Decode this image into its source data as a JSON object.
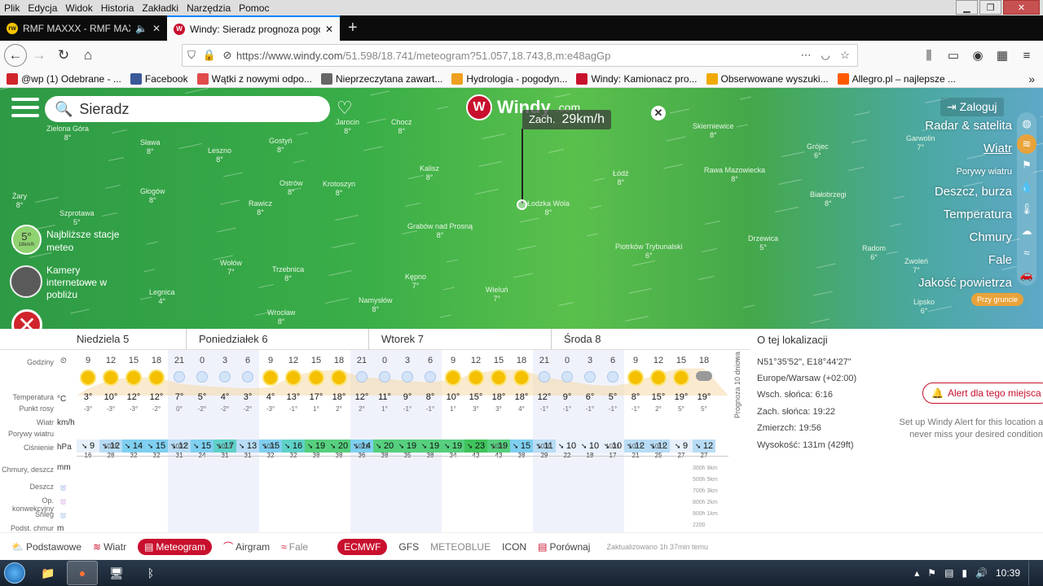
{
  "browser": {
    "menu": [
      "Plik",
      "Edycja",
      "Widok",
      "Historia",
      "Zakładki",
      "Narzędzia",
      "Pomoc"
    ],
    "tabs": [
      {
        "label": "RMF MAXXX - RMF MAXXX",
        "active": false
      },
      {
        "label": "Windy: Sieradz prognoza pogo",
        "active": true
      }
    ],
    "url_host": "https://www.windy.com",
    "url_path": "/51.598/18.741/meteogram?51.057,18.743,8,m:e48agGp",
    "bookmarks": [
      "@wp (1) Odebrane - ...",
      "Facebook",
      "Wątki z nowymi odpo...",
      "Nieprzeczytana zawart...",
      "Hydrologia - pogodyn...",
      "Windy: Kamionacz pro...",
      "Obserwowane wyszuki...",
      "Allegro.pl – najlepsze ..."
    ]
  },
  "map": {
    "search_value": "Sieradz",
    "logo_text": "Windy",
    "logo_suffix": ".com",
    "wind_dir": "Zach.",
    "wind_speed": "29km/h",
    "login": "Zaloguj",
    "layers": [
      {
        "label": "Radar & satelita",
        "sub": false,
        "active": false
      },
      {
        "label": "Wiatr",
        "sub": false,
        "active": true
      },
      {
        "label": "Porywy wiatru",
        "sub": true,
        "active": false
      },
      {
        "label": "Deszcz, burza",
        "sub": false,
        "active": false
      },
      {
        "label": "Temperatura",
        "sub": false,
        "active": false
      },
      {
        "label": "Chmury",
        "sub": false,
        "active": false
      },
      {
        "label": "Fale",
        "sub": false,
        "active": false
      },
      {
        "label": "Jakość powietrza",
        "sub": false,
        "active": false
      }
    ],
    "ground_label": "Przy gruncie",
    "station_value": "5°",
    "station_sub": "18km/h",
    "station_text": "Najbliższe stacje meteo",
    "camera_text": "Kamery internetowe w pobliżu",
    "cities": [
      {
        "n": "Zielona Góra",
        "t": "8°"
      },
      {
        "n": "Leszno",
        "t": "8°"
      },
      {
        "n": "Jarocin",
        "t": "8°"
      },
      {
        "n": "Gostyń",
        "t": "8°"
      },
      {
        "n": "Chocz",
        "t": "8°"
      },
      {
        "n": "Kalisz",
        "t": "8°"
      },
      {
        "n": "Krotoszyn",
        "t": "8°"
      },
      {
        "n": "Głogów",
        "t": "8°"
      },
      {
        "n": "Rawicz",
        "t": "8°"
      },
      {
        "n": "Ostrów",
        "t": "8°"
      },
      {
        "n": "Łódź",
        "t": "8°"
      },
      {
        "n": "Skierniewice",
        "t": "8°"
      },
      {
        "n": "Grójec",
        "t": "6°"
      },
      {
        "n": "Rawa Mazowiecka",
        "t": "8°"
      },
      {
        "n": "Białobrzegi",
        "t": "8°"
      },
      {
        "n": "Garwolin",
        "t": "7°"
      },
      {
        "n": "Grabów nad Prosną",
        "t": "8°"
      },
      {
        "n": "Łodzka Wola",
        "t": "8°"
      },
      {
        "n": "Piotrków Trybunalski",
        "t": "6°"
      },
      {
        "n": "Radom",
        "t": "6°"
      },
      {
        "n": "Wołów",
        "t": "7°"
      },
      {
        "n": "Trzebnica",
        "t": "8°"
      },
      {
        "n": "Kępno",
        "t": "7°"
      },
      {
        "n": "Wieluń",
        "t": "7°"
      },
      {
        "n": "Legnica",
        "t": "4°"
      },
      {
        "n": "Wrocław",
        "t": "8°"
      },
      {
        "n": "Namysłów",
        "t": "8°"
      },
      {
        "n": "Drzewica",
        "t": "5°"
      },
      {
        "n": "Zwoleń",
        "t": "7°"
      },
      {
        "n": "Lipsko",
        "t": "6°"
      },
      {
        "n": "Żary",
        "t": "8°"
      },
      {
        "n": "Sława",
        "t": "8°"
      },
      {
        "n": "Szprotawa",
        "t": "5°"
      }
    ]
  },
  "meteogram": {
    "days": [
      "Niedziela 5",
      "Poniedziałek 6",
      "Wtorek 7",
      "Środa 8"
    ],
    "labels": {
      "hours": "Godziny",
      "temp": "Temperatura",
      "dew": "Punkt rosy",
      "wind": "Wiatr",
      "gust": "Porywy wiatru",
      "pres": "Ciśnienie",
      "clouds": "Chmury, deszcz",
      "rain": "Deszcz",
      "conv": "Op. konwekcyjny",
      "snow": "Śnieg",
      "base": "Podst. chmur"
    },
    "units": {
      "temp": "°C",
      "wind": "km/h",
      "pres": "hPa",
      "clouds": "mm",
      "base": "m"
    },
    "hours": [
      "9",
      "12",
      "15",
      "18",
      "21",
      "0",
      "3",
      "6",
      "9",
      "12",
      "15",
      "18",
      "21",
      "0",
      "3",
      "6",
      "9",
      "12",
      "15",
      "18",
      "21",
      "0",
      "3",
      "6",
      "9",
      "12",
      "15",
      "18"
    ],
    "icons": [
      "sun",
      "sun",
      "sun",
      "sun",
      "moon",
      "moon",
      "moon",
      "moon",
      "sun",
      "sun",
      "sun",
      "sun",
      "moon",
      "moon",
      "moon",
      "moon",
      "sun",
      "sun",
      "sun",
      "sun",
      "moon",
      "moon",
      "moon",
      "moon",
      "sun",
      "sun",
      "sun",
      "cloud"
    ],
    "temps": [
      "3°",
      "10°",
      "12°",
      "12°",
      "7°",
      "5°",
      "4°",
      "3°",
      "4°",
      "13°",
      "17°",
      "18°",
      "12°",
      "11°",
      "9°",
      "8°",
      "10°",
      "15°",
      "18°",
      "18°",
      "12°",
      "9°",
      "6°",
      "5°",
      "8°",
      "15°",
      "19°",
      "19°"
    ],
    "dew": [
      "-3°",
      "-3°",
      "-3°",
      "-2°",
      "0°",
      "-2°",
      "-2°",
      "-2°",
      "-3°",
      "-1°",
      "1°",
      "2°",
      "2°",
      "1°",
      "-1°",
      "-1°",
      "1°",
      "3°",
      "3°",
      "4°",
      "-1°",
      "-1°",
      "-1°",
      "-1°",
      "-1°",
      "2°",
      "5°",
      "5°"
    ],
    "wind": [
      "9",
      "12",
      "14",
      "15",
      "12",
      "15",
      "17",
      "13",
      "15",
      "16",
      "19",
      "20",
      "14",
      "20",
      "19",
      "19",
      "19",
      "23",
      "19",
      "15",
      "11",
      "10",
      "10",
      "10",
      "12",
      "12",
      "9",
      "12"
    ],
    "gusts": [
      "16",
      "28",
      "32",
      "32",
      "31",
      "24",
      "31",
      "31",
      "32",
      "32",
      "38",
      "38",
      "36",
      "38",
      "35",
      "38",
      "34",
      "43",
      "43",
      "38",
      "29",
      "22",
      "18",
      "17",
      "21",
      "25",
      "27",
      "27"
    ],
    "pressure": [
      {
        "i": 1,
        "v": "1035"
      },
      {
        "i": 4,
        "v": "1032"
      },
      {
        "i": 6,
        "v": "1013"
      },
      {
        "i": 8,
        "v": "1031"
      },
      {
        "i": 12,
        "v": "1028"
      },
      {
        "i": 18,
        "v": "1031"
      },
      {
        "i": 20,
        "v": "1030"
      },
      {
        "i": 23,
        "v": "1031"
      },
      {
        "i": 24,
        "v": "1011"
      },
      {
        "i": 25,
        "v": "1011"
      }
    ],
    "altitudes": [
      "300h 9km",
      "500h 5km",
      "700h 3km",
      "800h 2km",
      "900h 1km",
      "2200"
    ],
    "side_label": "Prognoza 10 dniowa"
  },
  "info": {
    "title": "O tej lokalizacji",
    "coords": "N51°35'52\", E18°44'27\"",
    "tz": "Europe/Warsaw (+02:00)",
    "sunrise": "Wsch. słońca: 6:16",
    "sunset": "Zach. słońca: 19:22",
    "dusk": "Zmierzch: 19:56",
    "elevation": "Wysokość: 131m (429ft)",
    "alert_btn": "Alert dla tego miejsca",
    "alert_sub": "Set up Windy Alert for this location and never miss your desired condition"
  },
  "toolbar": {
    "items": [
      {
        "label": "Podstawowe",
        "icon": "⛅",
        "state": "normal"
      },
      {
        "label": "Wiatr",
        "icon": "≋",
        "state": "normal"
      },
      {
        "label": "Meteogram",
        "icon": "▤",
        "state": "active"
      },
      {
        "label": "Airgram",
        "icon": "⌒",
        "state": "normal"
      },
      {
        "label": "Fale",
        "icon": "≈",
        "state": "dim"
      }
    ],
    "models": [
      {
        "label": "ECMWF",
        "state": "active"
      },
      {
        "label": "GFS",
        "state": "normal"
      },
      {
        "label": "METEOBLUE",
        "state": "dim"
      },
      {
        "label": "ICON",
        "state": "normal"
      }
    ],
    "compare": "Porównaj",
    "updated": "Zaktualizowano 1h 37min temu"
  },
  "taskbar": {
    "clock": "10:39"
  }
}
